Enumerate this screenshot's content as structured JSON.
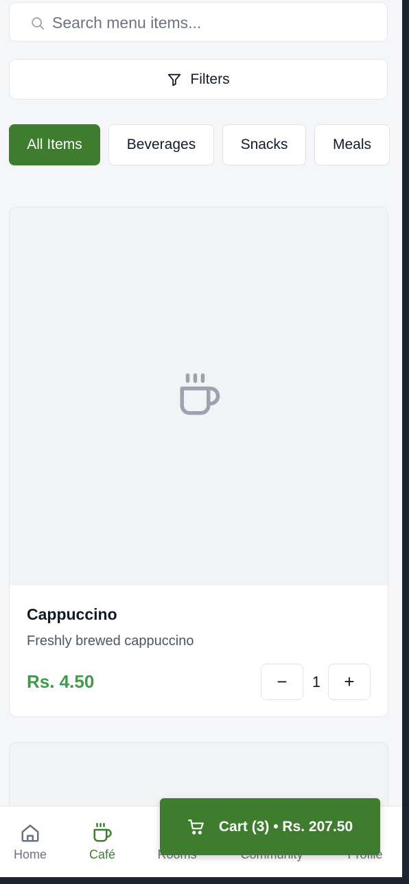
{
  "search": {
    "placeholder": "Search menu items..."
  },
  "filters": {
    "label": "Filters"
  },
  "categories": [
    {
      "label": "All Items",
      "active": true
    },
    {
      "label": "Beverages",
      "active": false
    },
    {
      "label": "Snacks",
      "active": false
    },
    {
      "label": "Meals",
      "active": false
    }
  ],
  "item": {
    "name": "Cappuccino",
    "description": "Freshly brewed cappuccino",
    "price": "Rs. 4.50",
    "quantity": "1",
    "decrement_label": "−",
    "increment_label": "+",
    "image_icon": "coffee-cup-icon"
  },
  "nav": [
    {
      "label": "Home",
      "icon": "home-icon",
      "active": false
    },
    {
      "label": "Café",
      "icon": "coffee-cup-icon",
      "active": true
    },
    {
      "label": "Rooms",
      "icon": "rooms-icon",
      "active": false
    },
    {
      "label": "Community",
      "icon": "community-icon",
      "active": false
    },
    {
      "label": "Profile",
      "icon": "profile-icon",
      "active": false
    }
  ],
  "cart": {
    "label": "Cart (3) • Rs. 207.50",
    "icon": "shopping-cart-icon"
  },
  "colors": {
    "accent": "#3e7d2e",
    "price": "#3f9a4a",
    "background": "#f4f6f8"
  }
}
